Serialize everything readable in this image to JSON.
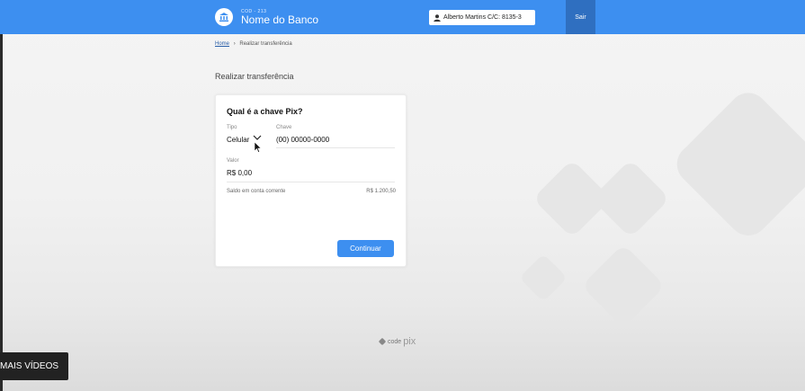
{
  "header": {
    "bank_code": "COD - 213",
    "bank_name": "Nome do Banco",
    "account_label": "Alberto Martins  C/C: 8135-3",
    "logout_label": "Sair",
    "accent_color": "#3d8ff0"
  },
  "breadcrumb": {
    "home": "Home",
    "separator": "›",
    "current": "Realizar transferência"
  },
  "page": {
    "title": "Realizar transferência"
  },
  "form": {
    "question": "Qual é a chave Pix?",
    "type_label": "Tipo",
    "type_value": "Celular",
    "key_label": "Chave",
    "key_value": "(00) 00000-0000",
    "amount_label": "Valor",
    "amount_value": "R$ 0,00",
    "balance_label": "Saldo em conta corrente",
    "balance_value": "R$ 1.200,50",
    "submit_label": "Continuar"
  },
  "footer": {
    "logo_text": "code",
    "logo_pix": "pix"
  },
  "overlay": {
    "more_videos": "MAIS VÍDEOS"
  }
}
